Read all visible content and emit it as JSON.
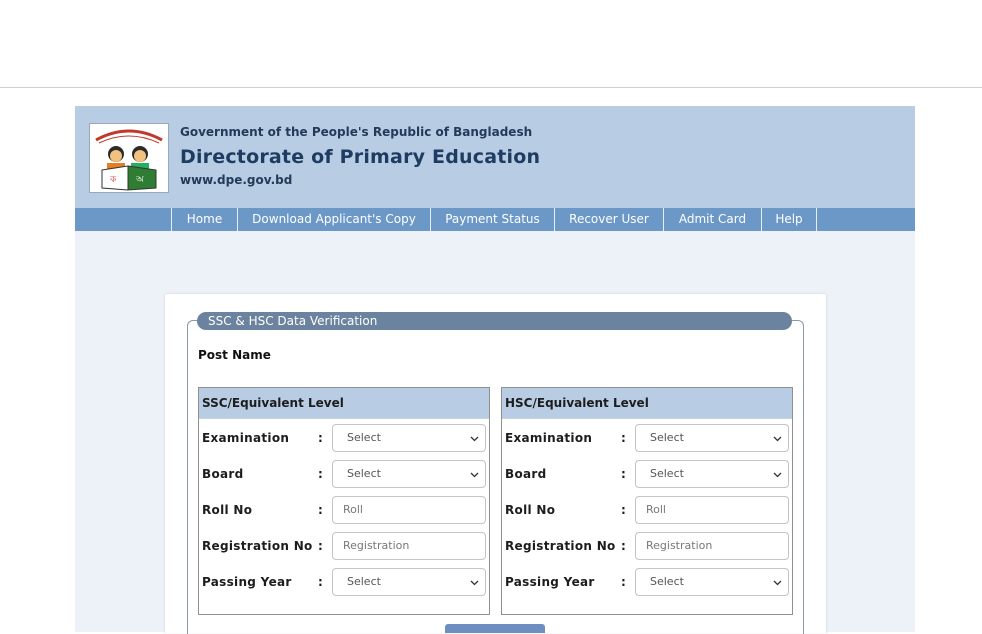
{
  "header": {
    "gov_text": "Government of the People's Republic of Bangladesh",
    "title": "Directorate of Primary Education",
    "url": "www.dpe.gov.bd",
    "logo": "dpe-logo"
  },
  "nav": {
    "items": [
      {
        "label": "Home"
      },
      {
        "label": "Download Applicant's Copy"
      },
      {
        "label": "Payment Status"
      },
      {
        "label": "Recover User"
      },
      {
        "label": "Admit Card"
      },
      {
        "label": "Help"
      }
    ]
  },
  "form": {
    "legend": "SSC & HSC Data Verification",
    "post_name_label": "Post Name",
    "ssc": {
      "title": "SSC/Equivalent Level",
      "examination": {
        "label": "Examination",
        "value": "Select"
      },
      "board": {
        "label": "Board",
        "value": "Select"
      },
      "roll": {
        "label": "Roll No",
        "placeholder": "Roll"
      },
      "registration": {
        "label": "Registration No",
        "placeholder": "Registration"
      },
      "passing_year": {
        "label": "Passing Year",
        "value": "Select"
      }
    },
    "hsc": {
      "title": "HSC/Equivalent Level",
      "examination": {
        "label": "Examination",
        "value": "Select"
      },
      "board": {
        "label": "Board",
        "value": "Select"
      },
      "roll": {
        "label": "Roll No",
        "placeholder": "Roll"
      },
      "registration": {
        "label": "Registration No",
        "placeholder": "Registration"
      },
      "passing_year": {
        "label": "Passing Year",
        "value": "Select"
      }
    },
    "colon": ":"
  },
  "colors": {
    "header_bg": "#b8cde3",
    "nav_bg": "#6c98c8",
    "page_bg": "#edf2f9",
    "legend_bg": "#6c83a0"
  }
}
